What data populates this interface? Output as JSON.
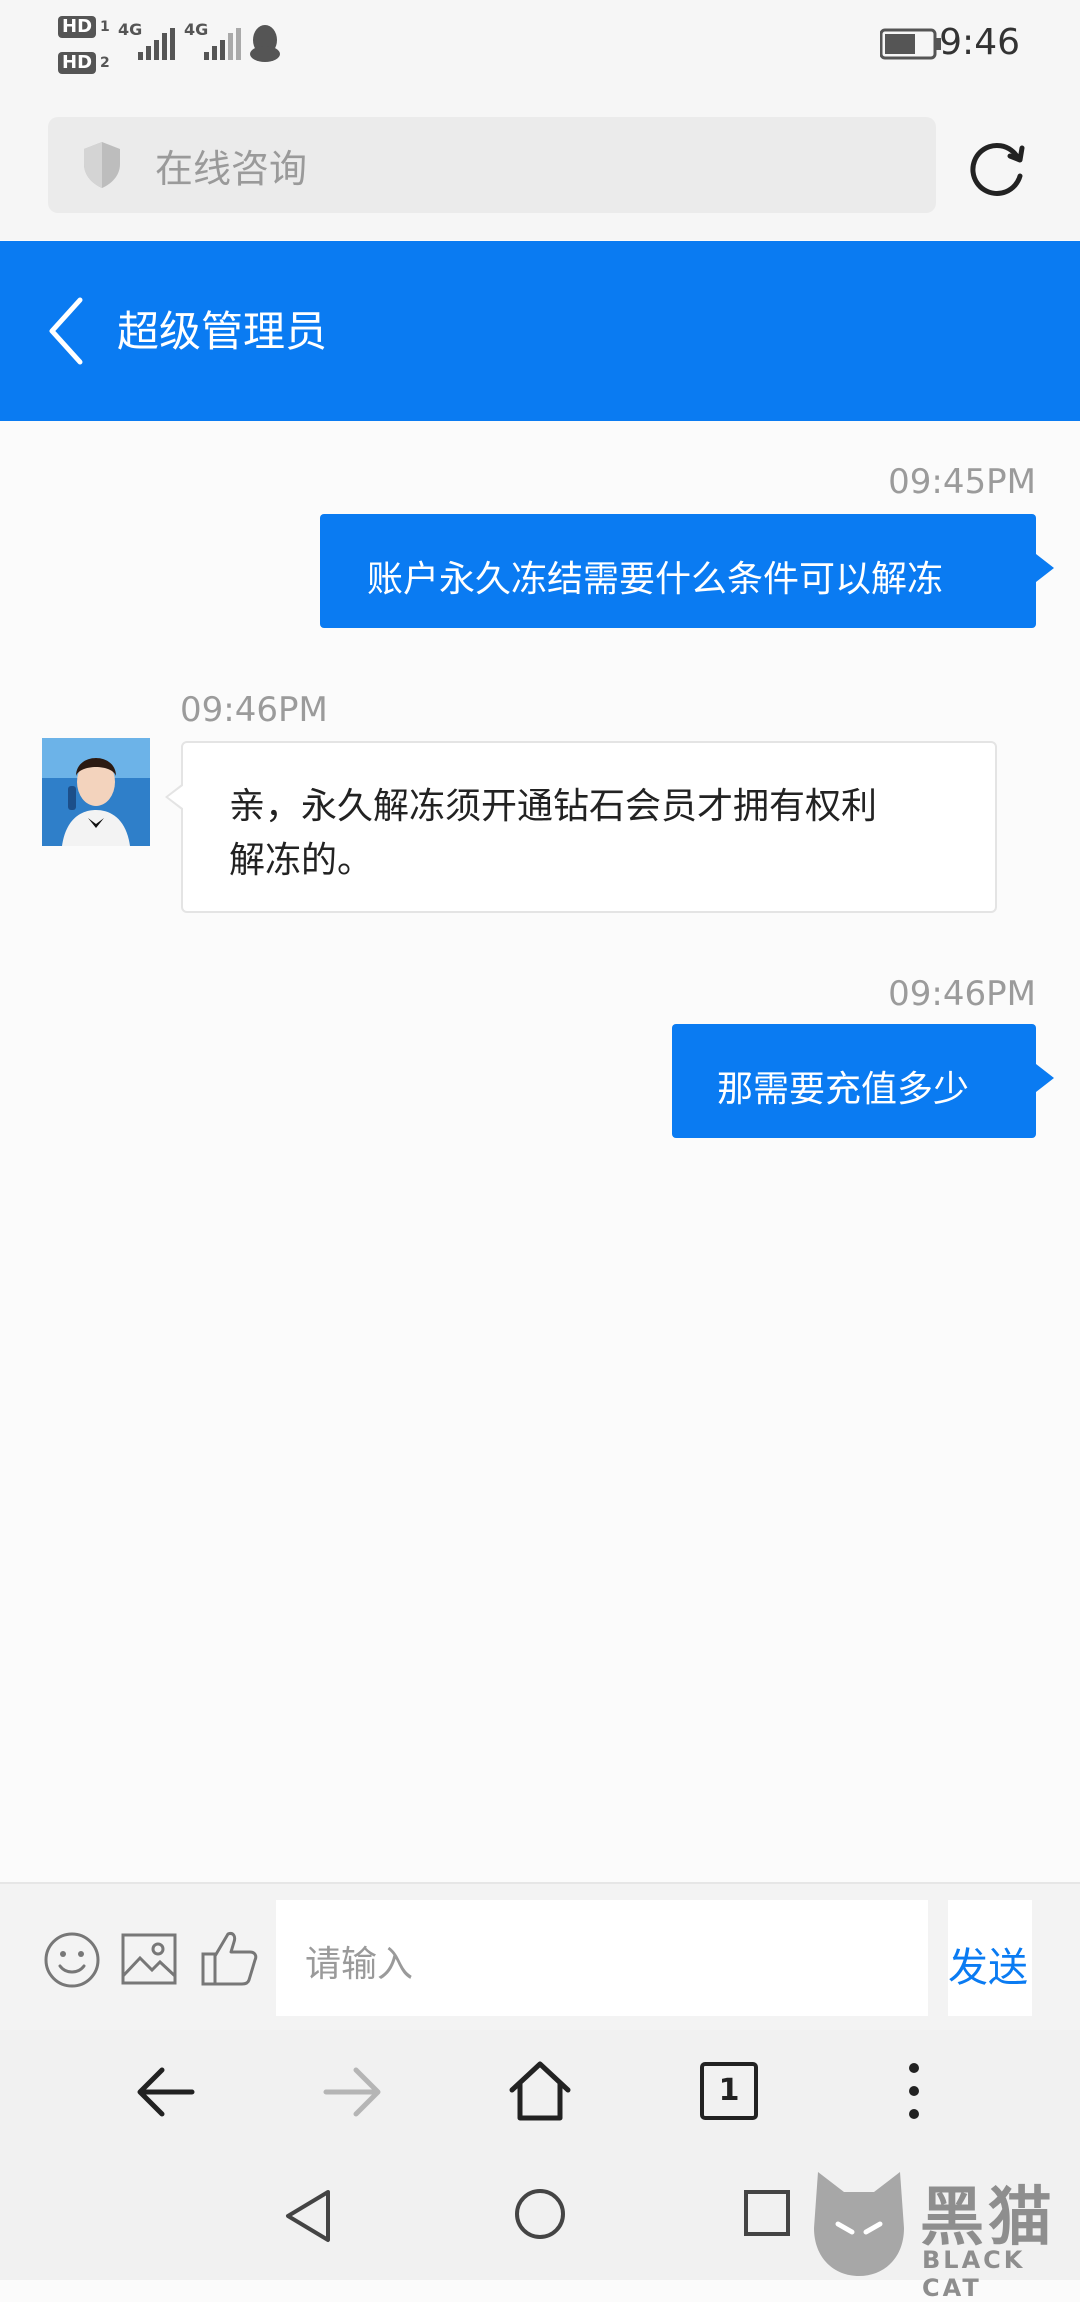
{
  "statusbar": {
    "sim1_badge": "HD",
    "sim1_num": "1",
    "sim2_badge": "HD",
    "sim2_num": "2",
    "net1": "4G",
    "net2": "4G",
    "time": "9:46"
  },
  "browser": {
    "address_placeholder": "在线咨询"
  },
  "header": {
    "title": "超级管理员"
  },
  "messages": [
    {
      "time": "09:45PM",
      "text": "账户永久冻结需要什么条件可以解冻"
    },
    {
      "time": "09:46PM",
      "text_line1": "亲，永久解冻须开通钻石会员才拥有权利",
      "text_line2": "解冻的。"
    },
    {
      "time": "09:46PM",
      "text": "那需要充值多少"
    }
  ],
  "input": {
    "placeholder": "请输入",
    "send_label": "发送"
  },
  "browser_toolbar": {
    "tab_count": "1"
  },
  "watermark": {
    "text_cn": "黑猫",
    "text_en": "BLACK CAT"
  },
  "colors": {
    "accent": "#0a7bf2",
    "background": "#fbfbfb"
  }
}
